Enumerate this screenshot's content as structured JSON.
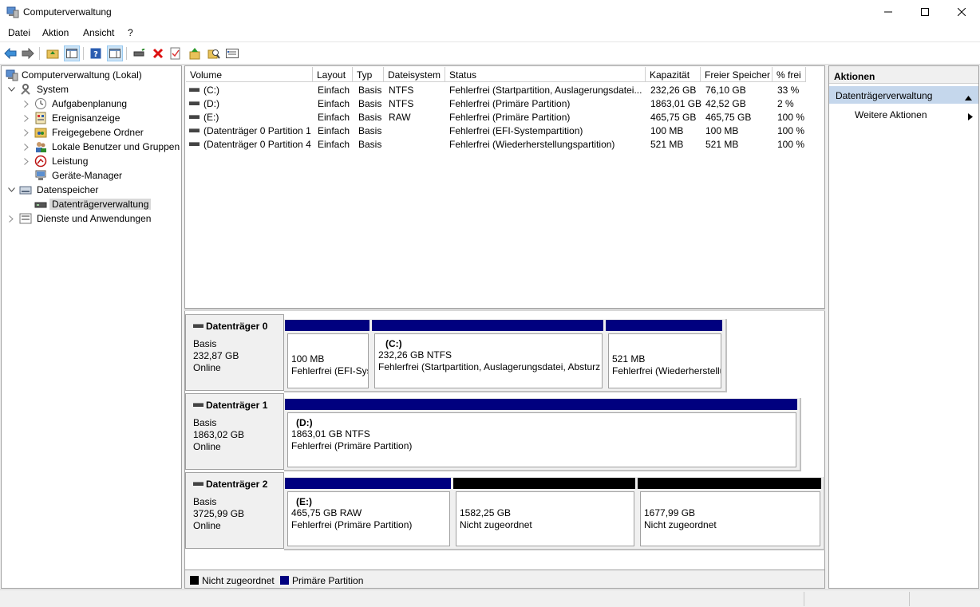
{
  "window": {
    "title": "Computerverwaltung",
    "minimize_glyph": "—",
    "maximize_glyph": "☐",
    "close_glyph": "✕"
  },
  "menu": [
    "Datei",
    "Aktion",
    "Ansicht",
    "?"
  ],
  "toolbar_icons": [
    "back-arrow-icon",
    "forward-arrow-icon",
    "up-folder-icon",
    "show-hide-tree-icon",
    "help-icon",
    "show-hide-actions-icon",
    "connect-disk-icon",
    "delete-icon",
    "properties-check-icon",
    "import-icon",
    "search-icon",
    "settings-icon"
  ],
  "tree": {
    "root": "Computerverwaltung (Lokal)",
    "system": "System",
    "aufgaben": "Aufgabenplanung",
    "ereignis": "Ereignisanzeige",
    "freigaben": "Freigegebene Ordner",
    "benutzer": "Lokale Benutzer und Gruppen",
    "leistung": "Leistung",
    "geraete": "Geräte-Manager",
    "datenspeicher": "Datenspeicher",
    "datentraeger": "Datenträgerverwaltung",
    "dienste": "Dienste und Anwendungen"
  },
  "volume_list": {
    "columns": [
      "Volume",
      "Layout",
      "Typ",
      "Dateisystem",
      "Status",
      "Kapazität",
      "Freier Speicher",
      "% frei"
    ],
    "rows": [
      [
        "(C:)",
        "Einfach",
        "Basis",
        "NTFS",
        "Fehlerfrei (Startpartition, Auslagerungsdatei...",
        "232,26 GB",
        "76,10 GB",
        "33 %"
      ],
      [
        "(D:)",
        "Einfach",
        "Basis",
        "NTFS",
        "Fehlerfrei (Primäre Partition)",
        "1863,01 GB",
        "42,52 GB",
        "2 %"
      ],
      [
        "(E:)",
        "Einfach",
        "Basis",
        "RAW",
        "Fehlerfrei (Primäre Partition)",
        "465,75 GB",
        "465,75 GB",
        "100 %"
      ],
      [
        "(Datenträger 0 Partition 1)",
        "Einfach",
        "Basis",
        "",
        "Fehlerfrei (EFI-Systempartition)",
        "100 MB",
        "100 MB",
        "100 %"
      ],
      [
        "(Datenträger 0 Partition 4)",
        "Einfach",
        "Basis",
        "",
        "Fehlerfrei (Wiederherstellungspartition)",
        "521 MB",
        "521 MB",
        "100 %"
      ]
    ]
  },
  "disks": [
    {
      "name": "Datenträger 0",
      "type": "Basis",
      "size": "232,87 GB",
      "state": "Online",
      "partitions": [
        {
          "label": "",
          "line1": "100 MB",
          "line2": "Fehlerfrei (EFI-Sys",
          "kind": "primary"
        },
        {
          "label": "(C:)",
          "line1": "232,26 GB NTFS",
          "line2": "Fehlerfrei (Startpartition, Auslagerungsdatei, Absturz",
          "kind": "primary"
        },
        {
          "label": "",
          "line1": "521 MB",
          "line2": "Fehlerfrei (Wiederherstellu",
          "kind": "primary"
        }
      ]
    },
    {
      "name": "Datenträger 1",
      "type": "Basis",
      "size": "1863,02 GB",
      "state": "Online",
      "partitions": [
        {
          "label": "(D:)",
          "line1": "1863,01 GB NTFS",
          "line2": "Fehlerfrei (Primäre Partition)",
          "kind": "primary"
        }
      ]
    },
    {
      "name": "Datenträger 2",
      "type": "Basis",
      "size": "3725,99 GB",
      "state": "Online",
      "partitions": [
        {
          "label": "(E:)",
          "line1": "465,75 GB RAW",
          "line2": "Fehlerfrei (Primäre Partition)",
          "kind": "primary"
        },
        {
          "label": "",
          "line1": "1582,25 GB",
          "line2": "Nicht zugeordnet",
          "kind": "unallocated"
        },
        {
          "label": "",
          "line1": "1677,99 GB",
          "line2": "Nicht zugeordnet",
          "kind": "unallocated"
        }
      ]
    }
  ],
  "legend": {
    "unallocated": "Nicht zugeordnet",
    "primary": "Primäre Partition"
  },
  "colors": {
    "primary_bar": "#00007f",
    "unallocated_bar": "#000000",
    "selected_section": "#c5d7ec"
  },
  "actions": {
    "header": "Aktionen",
    "section": "Datenträgerverwaltung",
    "more": "Weitere Aktionen"
  }
}
